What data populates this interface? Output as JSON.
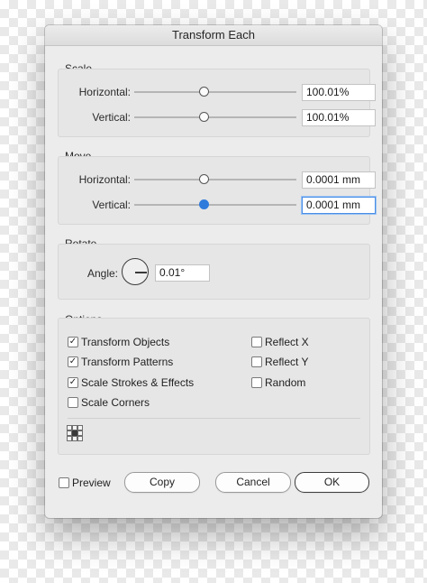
{
  "window": {
    "title": "Transform Each"
  },
  "scale": {
    "title": "Scale",
    "horizontal": {
      "label": "Horizontal:",
      "value": "100.01%",
      "slider_position": 0.5
    },
    "vertical": {
      "label": "Vertical:",
      "value": "100.01%",
      "slider_position": 0.5
    }
  },
  "move": {
    "title": "Move",
    "horizontal": {
      "label": "Horizontal:",
      "value": "0.0001 mm",
      "slider_position": 0.5
    },
    "vertical": {
      "label": "Vertical:",
      "value": "0.0001 mm",
      "slider_position": 0.5,
      "focused": true
    }
  },
  "rotate": {
    "title": "Rotate",
    "angle_label": "Angle:",
    "angle_value": "0.01°"
  },
  "options": {
    "title": "Options",
    "transform_objects": {
      "label": "Transform Objects",
      "checked": true
    },
    "transform_patterns": {
      "label": "Transform Patterns",
      "checked": true
    },
    "scale_strokes": {
      "label": "Scale Strokes & Effects",
      "checked": true
    },
    "scale_corners": {
      "label": "Scale Corners",
      "checked": false
    },
    "reflect_x": {
      "label": "Reflect X",
      "checked": false
    },
    "reflect_y": {
      "label": "Reflect Y",
      "checked": false
    },
    "random": {
      "label": "Random",
      "checked": false
    },
    "reference_point": {
      "icon": "reference-point-icon",
      "selected": "center"
    }
  },
  "footer": {
    "preview": {
      "label": "Preview",
      "checked": false
    },
    "copy_label": "Copy",
    "cancel_label": "Cancel",
    "ok_label": "OK"
  },
  "colors": {
    "accent": "#2f7bdc",
    "dialog_bg": "#ececec",
    "group_bg": "#e6e6e6"
  }
}
